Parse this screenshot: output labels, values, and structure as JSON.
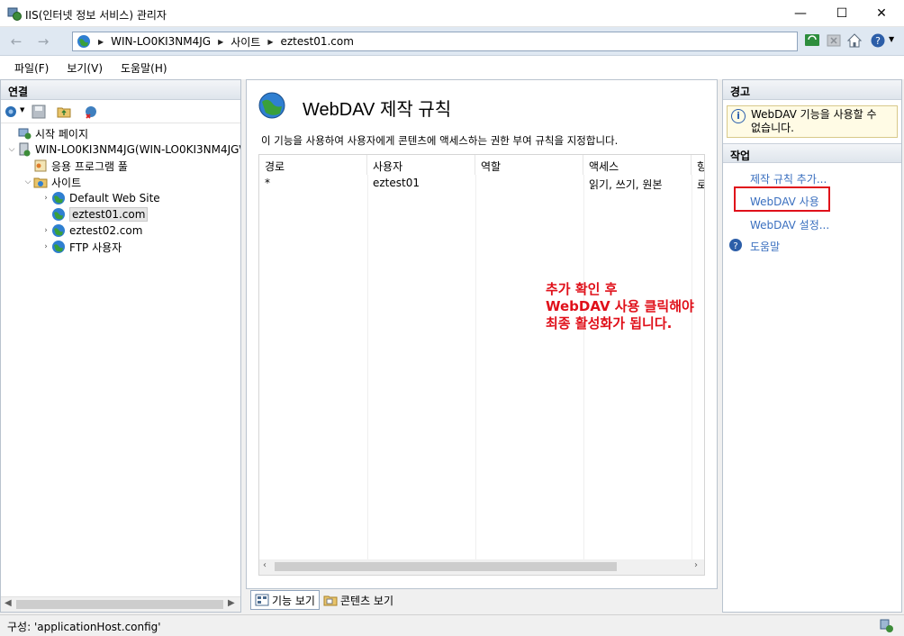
{
  "window": {
    "title": "IIS(인터넷 정보 서비스) 관리자",
    "minimize_glyph": "—",
    "maximize_glyph": "☐",
    "close_glyph": "✕"
  },
  "nav": {
    "back_glyph": "←",
    "forward_glyph": "→",
    "address_segments": [
      "WIN-LO0KI3NM4JG",
      "사이트",
      "eztest01.com"
    ]
  },
  "menu": {
    "items": [
      "파일(F)",
      "보기(V)",
      "도움말(H)"
    ]
  },
  "connections": {
    "header": "연결",
    "tree": {
      "start_page": "시작 페이지",
      "server": "WIN-LO0KI3NM4JG(WIN-LO0KI3NM4JG\\",
      "app_pools": "응용 프로그램 풀",
      "sites": "사이트",
      "site_items": [
        "Default Web Site",
        "eztest01.com",
        "eztest02.com",
        "FTP 사용자"
      ]
    }
  },
  "center": {
    "title": "WebDAV 제작 규칙",
    "description": "이 기능을 사용하여 사용자에게 콘텐츠에 액세스하는 권한 부여 규칙을 지정합니다.",
    "table": {
      "columns": [
        "경로",
        "사용자",
        "역할",
        "액세스",
        "항"
      ],
      "rows": [
        {
          "path": "*",
          "user": "eztest01",
          "role": "",
          "access": "읽기, 쓰기, 원본",
          "extra": "로"
        }
      ]
    },
    "annotation": [
      "추가 확인 후",
      "WebDAV 사용 클릭해야",
      "최종 활성화가 됩니다."
    ],
    "annotation_color": "#e0101a"
  },
  "view_tabs": {
    "features": "기능 보기",
    "content": "콘텐츠 보기"
  },
  "alerts": {
    "header": "경고",
    "message_line1": "WebDAV 기능을 사용할 수",
    "message_line2": "없습니다."
  },
  "actions": {
    "header": "작업",
    "add_rule": "제작 규칙 추가...",
    "enable": "WebDAV 사용",
    "settings": "WebDAV 설정...",
    "help": "도움말"
  },
  "status": {
    "text": "구성: 'applicationHost.config'"
  },
  "colors": {
    "link": "#3a6fbf",
    "highlight_border": "#e0101a"
  }
}
